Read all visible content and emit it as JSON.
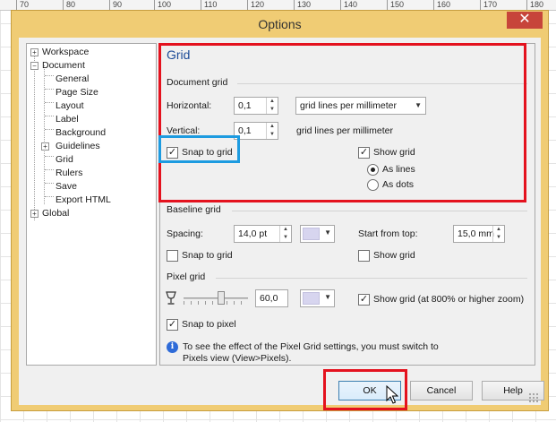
{
  "ruler": {
    "ticks": [
      "70",
      "80",
      "90",
      "100",
      "110",
      "120",
      "130",
      "140",
      "150",
      "160",
      "170",
      "180"
    ]
  },
  "window": {
    "title": "Options",
    "close_glyph": "✕"
  },
  "tree": {
    "workspace": "Workspace",
    "document": "Document",
    "children": [
      "General",
      "Page Size",
      "Layout",
      "Label",
      "Background",
      "Guidelines",
      "Grid",
      "Rulers",
      "Save",
      "Export HTML"
    ],
    "global": "Global"
  },
  "panel": {
    "title": "Grid",
    "document_grid": {
      "heading": "Document grid",
      "horizontal_label": "Horizontal:",
      "horizontal_value": "0,1",
      "horizontal_unit": "grid lines per millimeter",
      "vertical_label": "Vertical:",
      "vertical_value": "0,1",
      "vertical_unit": "grid lines per millimeter",
      "snap_label": "Snap to grid",
      "snap_checked": true,
      "show_label": "Show grid",
      "show_checked": true,
      "as_lines": "As lines",
      "as_dots": "As dots",
      "selected_mode": "As lines"
    },
    "baseline_grid": {
      "heading": "Baseline grid",
      "spacing_label": "Spacing:",
      "spacing_value": "14,0 pt",
      "start_label": "Start from top:",
      "start_value": "15,0 mm",
      "snap_label": "Snap to grid",
      "snap_checked": false,
      "show_label": "Show grid",
      "show_checked": false
    },
    "pixel_grid": {
      "heading": "Pixel grid",
      "opacity_value": "60,0",
      "opacity_level": 0.6,
      "show_label": "Show grid (at 800% or higher zoom)",
      "show_checked": true,
      "snap_label": "Snap to pixel",
      "snap_checked": true
    },
    "info_text": "To see the effect of the Pixel Grid settings, you must switch to Pixels view (View>Pixels)."
  },
  "buttons": {
    "ok": "OK",
    "cancel": "Cancel",
    "help": "Help"
  },
  "colors": {
    "title_bar": "#f0cc74",
    "close_button": "#c7453a",
    "panel_title": "#1e4c98",
    "highlight_red": "#e4121e",
    "highlight_blue": "#1d9be0",
    "swatch": "#d7d5ef"
  },
  "icons": {
    "close": "close-icon",
    "expander": "plus-icon",
    "collapser": "minus-icon",
    "info": "info-icon",
    "opacity": "goblet-icon",
    "cursor": "pointer-cursor-icon"
  }
}
